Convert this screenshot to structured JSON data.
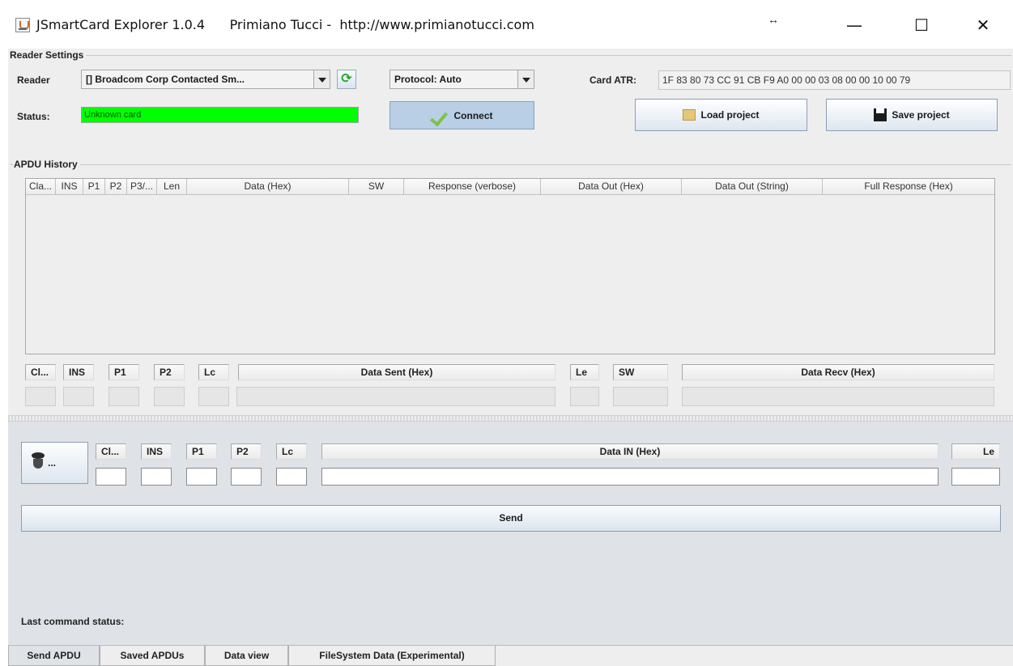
{
  "window": {
    "title": "JSmartCard Explorer 1.0.4      Primiano Tucci -  http://www.primianotucci.com",
    "resize_glyph": "↔",
    "min_glyph": "—",
    "max_glyph": "☐",
    "close_glyph": "✕"
  },
  "reader_settings": {
    "legend": "Reader Settings",
    "reader_label": "Reader",
    "reader_value": "[] Broadcom Corp Contacted Sm...",
    "protocol_value": "Protocol: Auto",
    "status_label": "Status:",
    "status_value": "Unknown card",
    "status_color": "#00ff00",
    "connect_label": "Connect",
    "card_atr_label": "Card ATR:",
    "card_atr_value": "1F 83 80 73 CC 91 CB F9 A0 00 00 03 08 00 00 10 00 79",
    "load_project_label": "Load project",
    "save_project_label": "Save project"
  },
  "apdu_history": {
    "legend": "APDU History",
    "columns": [
      "Cla...",
      "INS",
      "P1",
      "P2",
      "P3/...",
      "Len",
      "Data (Hex)",
      "SW",
      "Response (verbose)",
      "Data Out (Hex)",
      "Data Out (String)",
      "Full Response (Hex)"
    ],
    "detail_headers": {
      "cl": "Cl...",
      "ins": "INS",
      "p1": "P1",
      "p2": "P2",
      "lc": "Lc",
      "data_sent": "Data Sent (Hex)",
      "le": "Le",
      "sw": "SW",
      "data_recv": "Data Recv (Hex)"
    }
  },
  "send_apdu": {
    "headers": {
      "cl": "Cl...",
      "ins": "INS",
      "p1": "P1",
      "p2": "P2",
      "lc": "Lc",
      "data_in": "Data IN (Hex)",
      "le": "Le"
    },
    "preset_button_label": "...",
    "send_label": "Send",
    "last_command_status_label": "Last command status:"
  },
  "tabs": [
    {
      "label": "Send APDU",
      "active": true
    },
    {
      "label": "Saved APDUs",
      "active": false
    },
    {
      "label": "Data view",
      "active": false
    },
    {
      "label": "FileSystem Data (Experimental)",
      "active": false
    }
  ],
  "icons": {
    "app": "java-app-icon",
    "refresh": "refresh-icon",
    "connect": "checkmark-icon",
    "load": "folder-icon",
    "save": "floppy-disk-icon",
    "preset": "spool-icon"
  }
}
